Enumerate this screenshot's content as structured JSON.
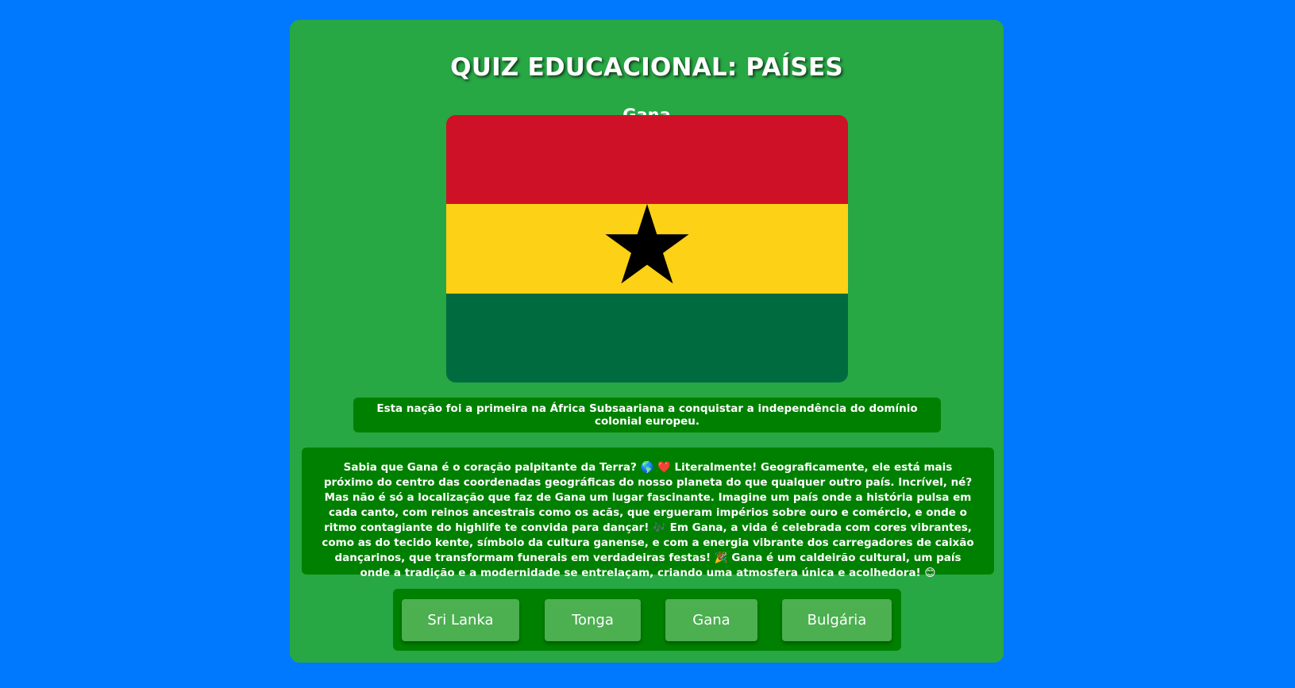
{
  "quiz": {
    "title": "QUIZ EDUCACIONAL: PAÍSES",
    "country_name": "Gana",
    "flag": {
      "country": "Gana",
      "stripe_colors": [
        "#ce1126",
        "#fcd116",
        "#006b3f"
      ],
      "star_color": "#000000",
      "star_icon": "star-icon"
    },
    "hint": "Esta nação foi a primeira na África Subsaariana a conquistar a independência do domínio colonial europeu.",
    "fact": "Sabia que Gana é o coração palpitante da Terra? 🌎 ❤️ Literalmente! Geograficamente, ele está mais próximo do centro das coordenadas geográficas do nosso planeta do que qualquer outro país. Incrível, né? Mas não é só a localização que faz de Gana um lugar fascinante. Imagine um país onde a história pulsa em cada canto, com reinos ancestrais como os acãs, que ergueram impérios sobre ouro e comércio, e onde o ritmo contagiante do highlife te convida para dançar! 🎶 Em Gana, a vida é celebrada com cores vibrantes, como as do tecido kente, símbolo da cultura ganense, e com a energia vibrante dos carregadores de caixão dançarinos, que transformam funerais em verdadeiras festas! 🎉 Gana é um caldeirão cultural, um país onde a tradição e a modernidade se entrelaçam, criando uma atmosfera única e acolhedora! 😊",
    "options": [
      "Sri Lanka",
      "Tonga",
      "Gana",
      "Bulgária"
    ]
  },
  "colors": {
    "page_background": "#0079ff",
    "card_background": "#28a745",
    "panel_background": "#008000",
    "button_background": "#4caf50",
    "text": "#ffffff"
  }
}
